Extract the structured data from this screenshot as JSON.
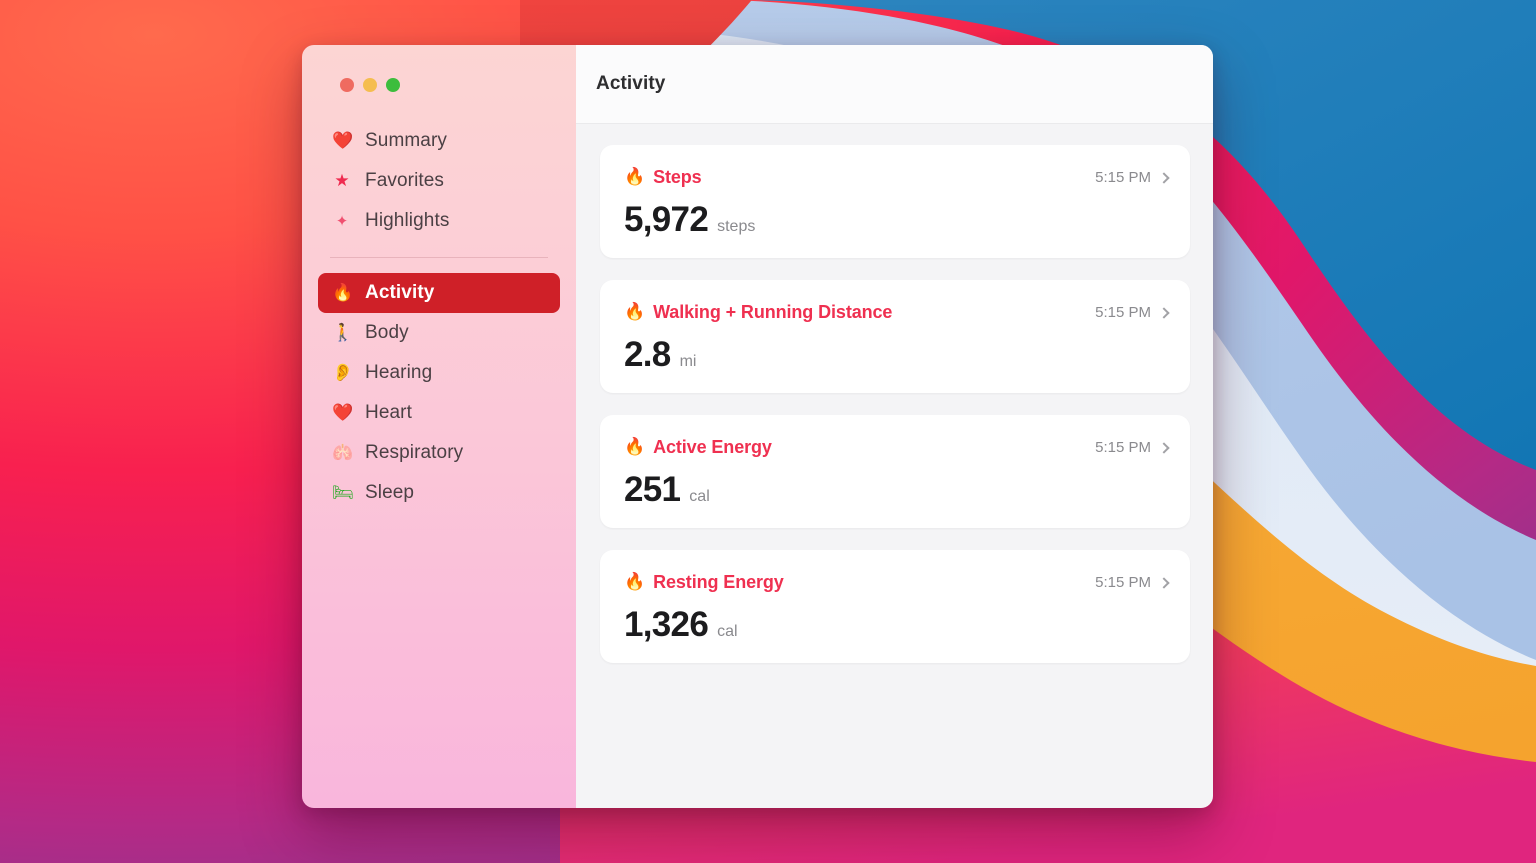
{
  "window": {
    "app_title": "Activity",
    "traffic_lights": [
      {
        "name": "close-button",
        "color": "#ef6b60"
      },
      {
        "name": "minimize-button",
        "color": "#f5bd4f"
      },
      {
        "name": "maximize-button",
        "color": "#3dbd3d"
      }
    ]
  },
  "sidebar": {
    "top_items": [
      {
        "label": "Summary",
        "icon": "heart-icon",
        "glyph": "❤️",
        "selected": false
      },
      {
        "label": "Favorites",
        "icon": "star-icon",
        "glyph": "★",
        "selected": false
      },
      {
        "label": "Highlights",
        "icon": "sparkles-icon",
        "glyph": "✦",
        "selected": false
      }
    ],
    "category_items": [
      {
        "label": "Activity",
        "icon": "flame-icon",
        "glyph": "🔥",
        "selected": true
      },
      {
        "label": "Body",
        "icon": "walking-icon",
        "glyph": "🚶",
        "selected": false
      },
      {
        "label": "Hearing",
        "icon": "ear-icon",
        "glyph": "👂",
        "selected": false
      },
      {
        "label": "Heart",
        "icon": "heart-icon",
        "glyph": "❤️",
        "selected": false
      },
      {
        "label": "Respiratory",
        "icon": "lungs-icon",
        "glyph": "🫁",
        "selected": false
      },
      {
        "label": "Sleep",
        "icon": "bed-icon",
        "glyph": "🛏",
        "selected": false
      }
    ],
    "selected_bg": "#cf2028"
  },
  "main": {
    "header_title": "Activity",
    "cards": [
      {
        "label": "Steps",
        "icon": "flame-icon",
        "time": "5:15 PM",
        "value": "5,972",
        "unit": "steps"
      },
      {
        "label": "Walking + Running Distance",
        "icon": "flame-icon",
        "time": "5:15 PM",
        "value": "2.8",
        "unit": "mi"
      },
      {
        "label": "Active Energy",
        "icon": "flame-icon",
        "time": "5:15 PM",
        "value": "251",
        "unit": "cal"
      },
      {
        "label": "Resting Energy",
        "icon": "flame-icon",
        "time": "5:15 PM",
        "value": "1,326",
        "unit": "cal"
      }
    ],
    "accent_color": "#ef3050"
  }
}
